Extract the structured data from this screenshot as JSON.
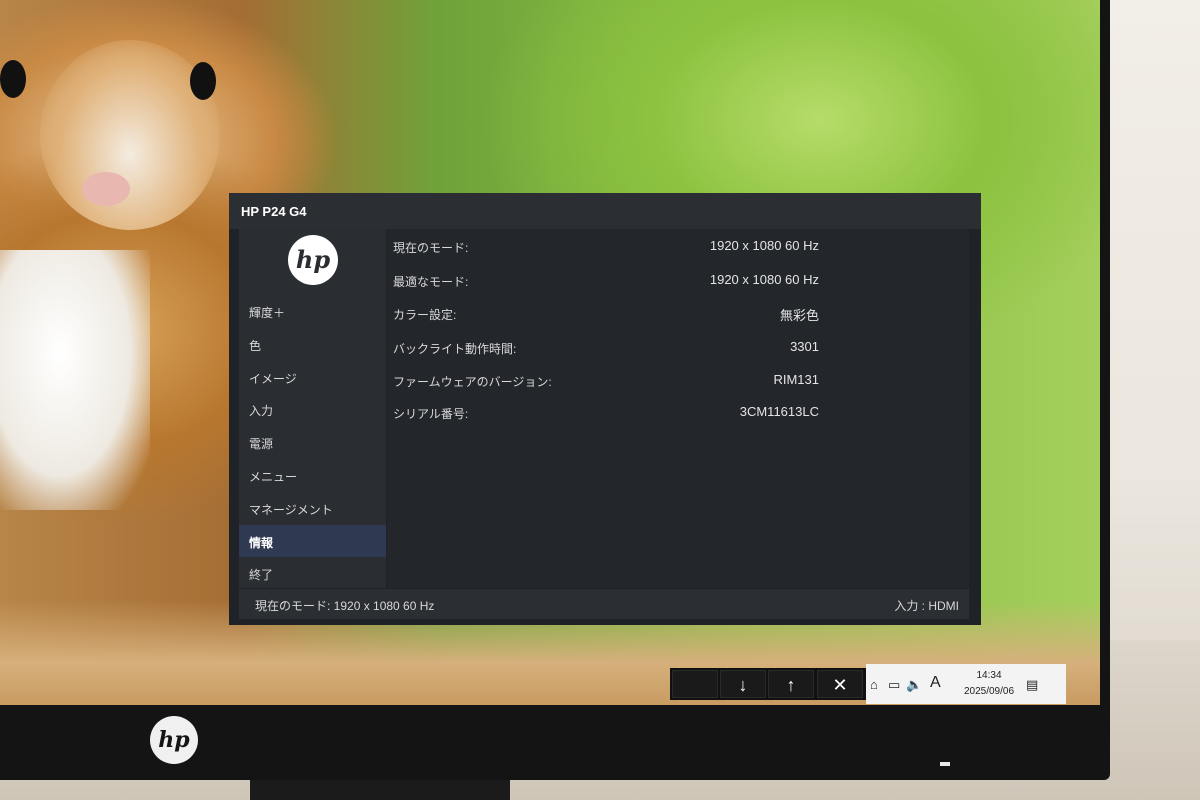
{
  "osd": {
    "title": "HP P24 G4",
    "logo_text": "hp",
    "menu": [
      {
        "label": "輝度＋",
        "active": false
      },
      {
        "label": "色",
        "active": false
      },
      {
        "label": "イメージ",
        "active": false
      },
      {
        "label": "入力",
        "active": false
      },
      {
        "label": "電源",
        "active": false
      },
      {
        "label": "メニュー",
        "active": false
      },
      {
        "label": "マネージメント",
        "active": false
      },
      {
        "label": "情報",
        "active": true
      },
      {
        "label": "終了",
        "active": false
      }
    ],
    "info": [
      {
        "label": "現在のモード:",
        "value": "1920 x 1080  60 Hz"
      },
      {
        "label": "最適なモード:",
        "value": "1920 x 1080  60 Hz"
      },
      {
        "label": "カラー設定:",
        "value": "無彩色"
      },
      {
        "label": "バックライト動作時間:",
        "value": "3301"
      },
      {
        "label": "ファームウェアのバージョン:",
        "value": "RIM131"
      },
      {
        "label": "シリアル番号:",
        "value": "3CM11613LC"
      }
    ],
    "footer": {
      "current_mode": "現在のモード:  1920 x 1080  60 Hz",
      "input": "入力 : HDMI"
    }
  },
  "buttons": {
    "down": "↓",
    "up": "↑",
    "close": "✕"
  },
  "taskbar": {
    "input_icon_letter": "A",
    "time": "14:34",
    "date": "2025/09/06"
  },
  "bezel": {
    "logo_text": "hp"
  }
}
